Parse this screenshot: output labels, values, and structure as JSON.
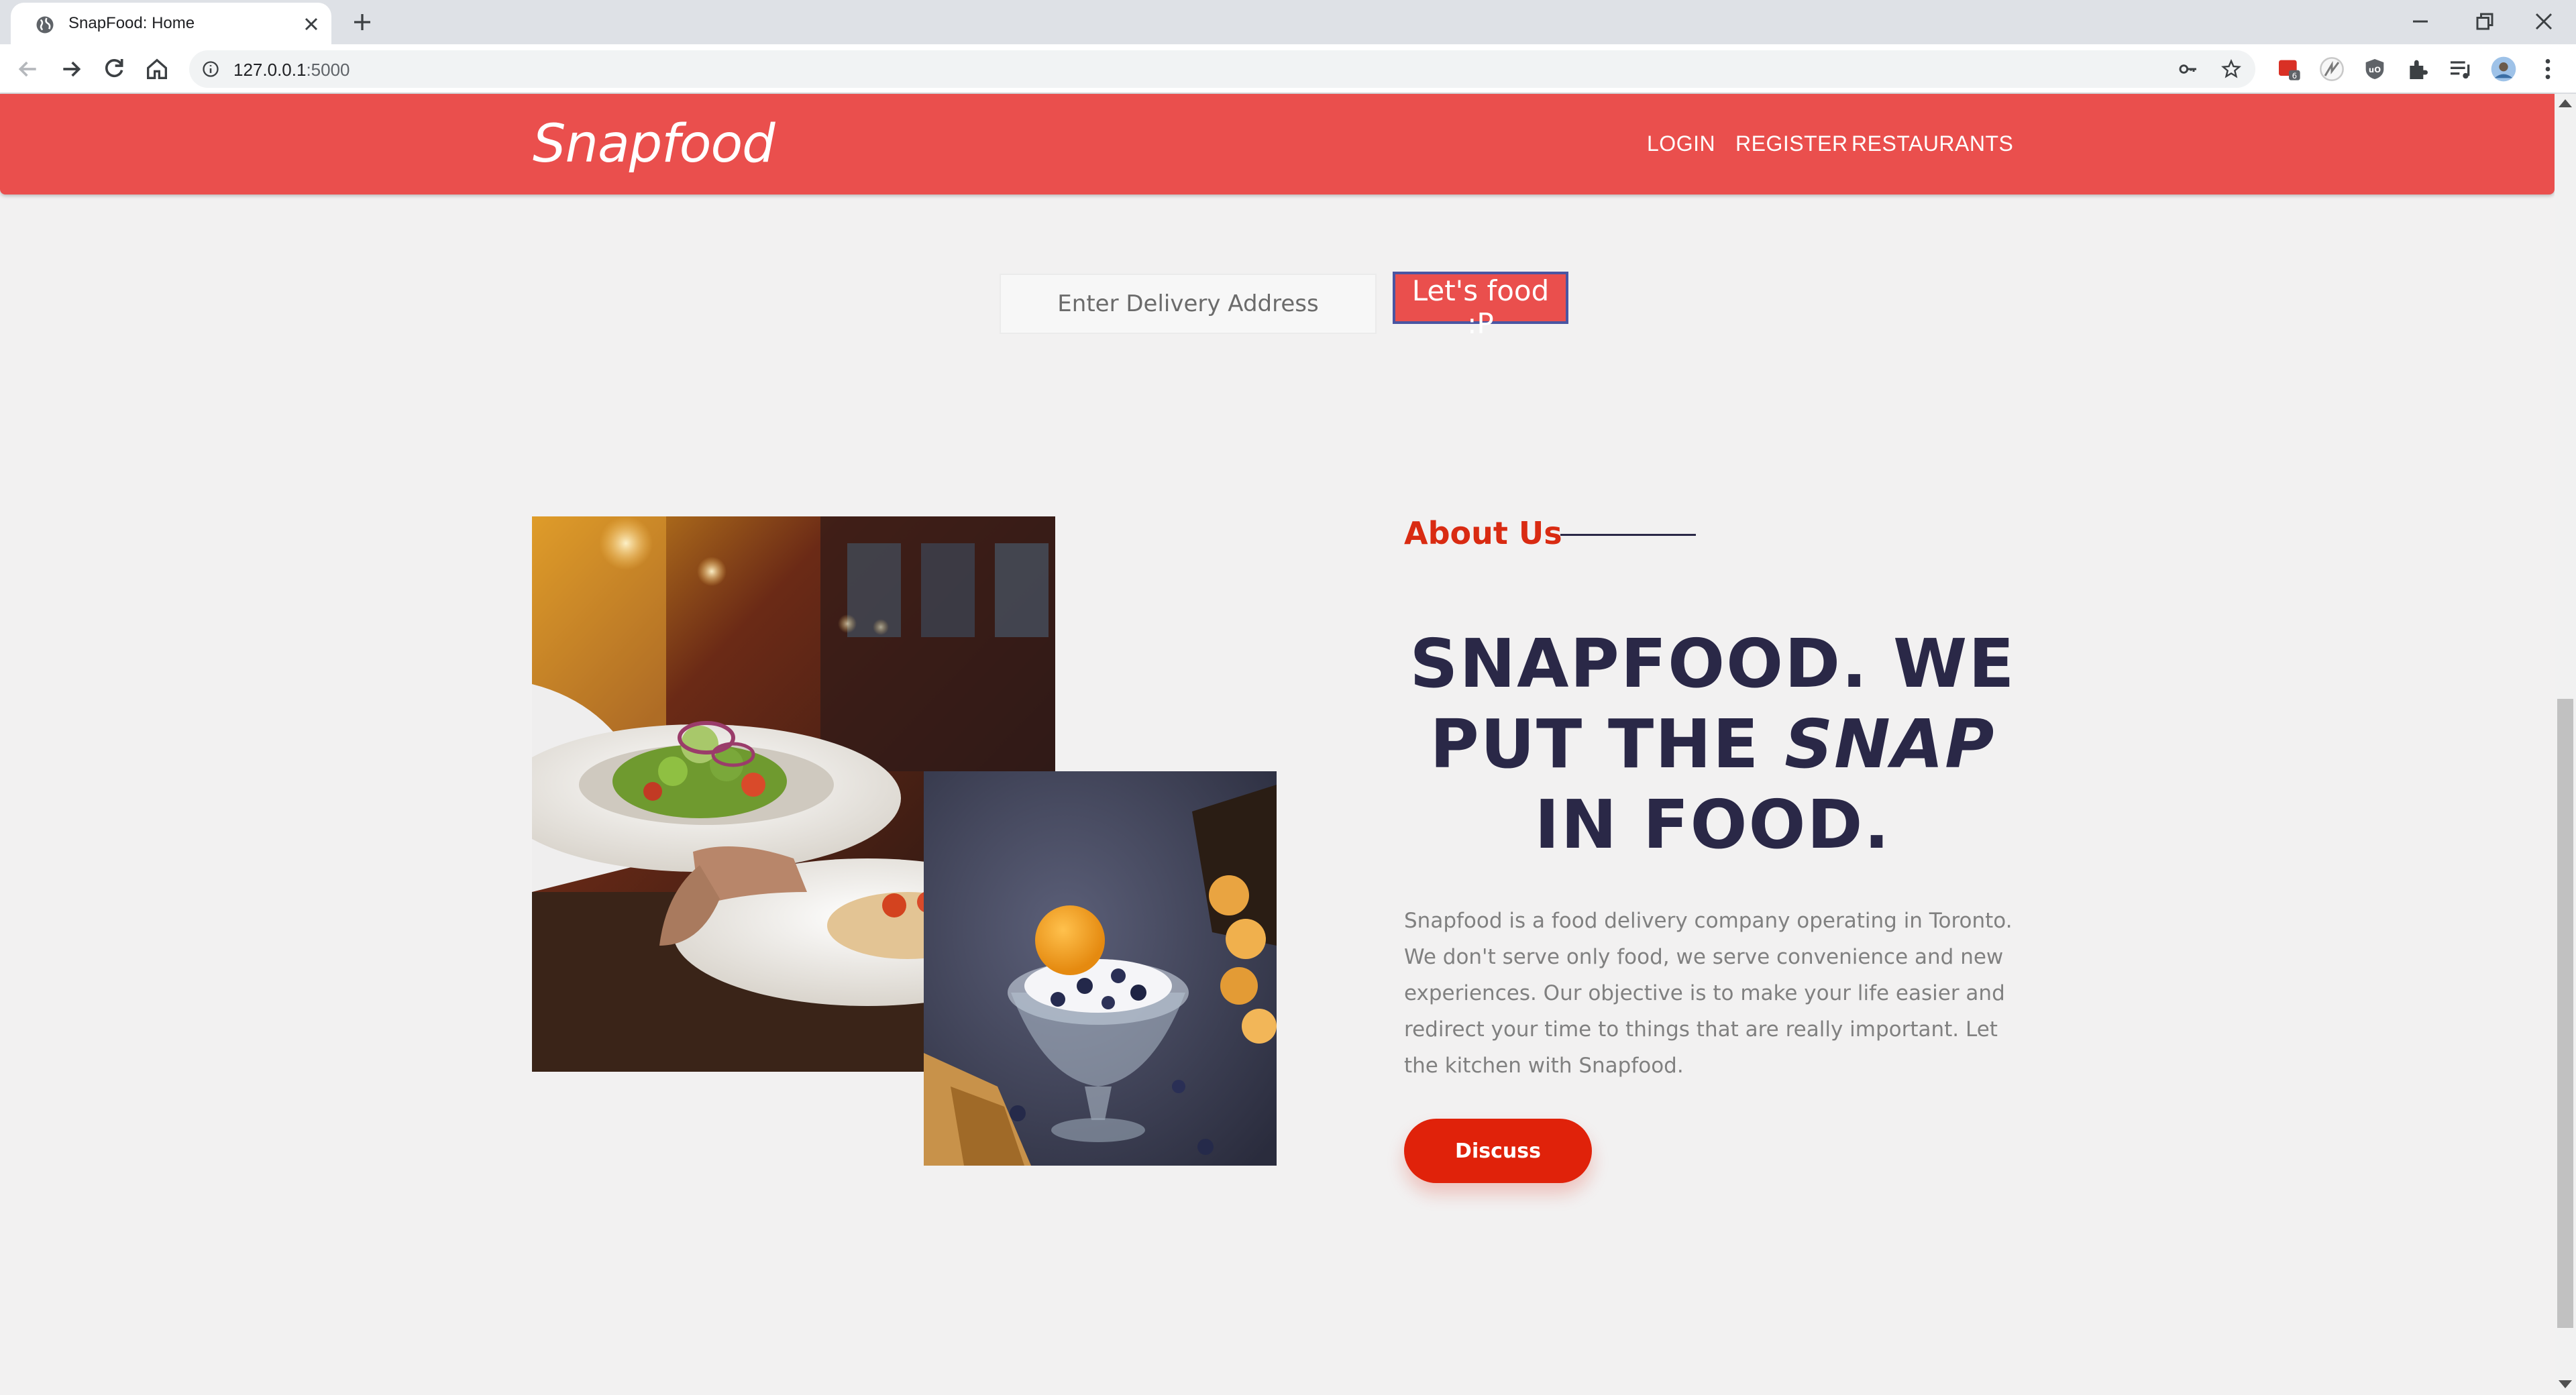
{
  "browser": {
    "tab_title": "SnapFood: Home",
    "url_host": "127.0.0.1",
    "url_port": ":5000"
  },
  "nav": {
    "brand": "Snapfood",
    "links": [
      "LOGIN",
      "REGISTER",
      "RESTAURANTS"
    ]
  },
  "search": {
    "placeholder": "Enter Delivery Address",
    "button_label": "Let's food :P"
  },
  "about": {
    "label": "About Us",
    "headline_part1": "SNAPFOOD. WE PUT THE ",
    "headline_em": "SNAP",
    "headline_part2": " IN FOOD.",
    "body": "Snapfood is a food delivery company operating in Toronto. We don't serve only food, we serve convenience and new experiences. Our objective is to make your life easier and redirect your time to things that are really important. Let the kitchen with Snapfood.",
    "button_label": "Discuss"
  },
  "colors": {
    "nav_bg": "#ea4f4d",
    "accent": "#d92b12",
    "headline": "#2a2847",
    "button": "#e0220a"
  }
}
